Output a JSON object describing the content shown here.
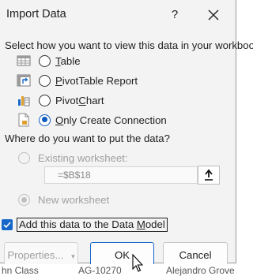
{
  "dialog": {
    "title": "Import Data",
    "help_label": "?",
    "view_prompt": "Select how you want to view this data in your workbook.",
    "view_options": [
      {
        "label_pre": "",
        "accel": "T",
        "label_post": "able",
        "selected": false,
        "icon": "table-icon"
      },
      {
        "label_pre": "",
        "accel": "P",
        "label_post": "ivotTable Report",
        "selected": false,
        "icon": "pivottable-icon"
      },
      {
        "label_pre": "Pivot",
        "accel": "C",
        "label_post": "hart",
        "selected": false,
        "icon": "pivotchart-icon"
      },
      {
        "label_pre": "",
        "accel": "O",
        "label_post": "nly Create Connection",
        "selected": true,
        "icon": "connection-icon"
      }
    ],
    "location_prompt": "Where do you want to put the data?",
    "existing_label": "Existing worksheet:",
    "cell_reference": "=$B$18",
    "new_label": "New worksheet",
    "data_model_label_pre": "Add this data to the Data ",
    "data_model_accel": "M",
    "data_model_label_post": "odel",
    "data_model_checked": true,
    "buttons": {
      "properties": "Properties...",
      "ok": "OK",
      "cancel": "Cancel"
    }
  },
  "background_sheet": {
    "cells": [
      "hn Class",
      "AG-10270",
      "Alejandro Grove"
    ]
  }
}
